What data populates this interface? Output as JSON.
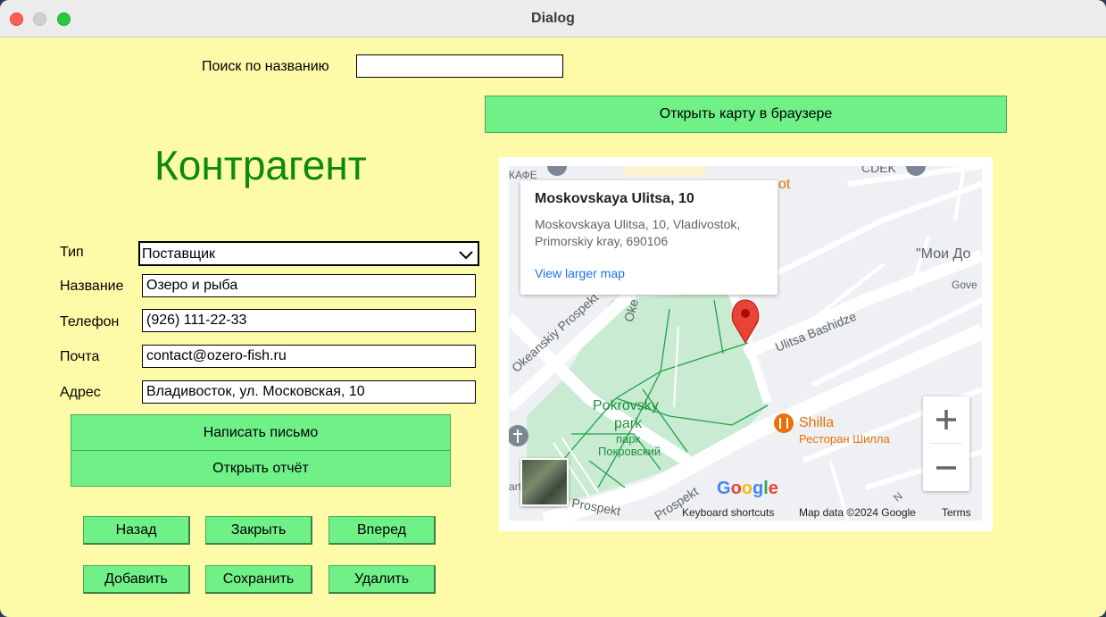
{
  "window": {
    "title": "Dialog"
  },
  "search": {
    "label": "Поиск по названию",
    "value": ""
  },
  "open_map_button": "Открыть карту в браузере",
  "heading": "Контрагент",
  "form": {
    "type_label": "Тип",
    "type_value": "Поставщик",
    "name_label": "Название",
    "name_value": "Озеро и рыба",
    "phone_label": "Телефон",
    "phone_value": "(926) 111-22-33",
    "email_label": "Почта",
    "email_value": "contact@ozero-fish.ru",
    "address_label": "Адрес",
    "address_value": "Владивосток, ул. Московская, 10"
  },
  "actions": {
    "write_letter": "Написать письмо",
    "open_report": "Открыть отчёт"
  },
  "nav": {
    "back": "Назад",
    "close": "Закрыть",
    "forward": "Вперед",
    "add": "Добавить",
    "save": "Сохранить",
    "delete": "Удалить"
  },
  "map": {
    "info_title": "Moskovskaya Ulitsa, 10",
    "info_address": "Moskovskaya Ulitsa, 10, Vladivostok, Primorskiy kray, 690106",
    "view_larger": "View larger map",
    "labels": {
      "okeanskiy": "Okeanskiy Prospekt",
      "prospekt": "Prospekt",
      "ulitsa_bashidze": "Ulitsa Bashidze",
      "park_en_1": "Pokrovsky",
      "park_en_2": "park",
      "park_ru_1": "парк",
      "park_ru_2": "Покровский",
      "shilla": "Shilla",
      "shilla_ru": "Ресторан Шилла",
      "moi_do": "\"Мои До",
      "gove": "Gove",
      "kafe": "КАФЕ",
      "ot": "ot",
      "cdek": "CDEK",
      "oke": "Oke",
      "prospekt_lower": "Prospekt",
      "art": "art",
      "n": "N"
    },
    "google": "Google",
    "footer_shortcuts": "Keyboard shortcuts",
    "footer_data": "Map data ©2024 Google",
    "footer_terms": "Terms"
  },
  "colors": {
    "window_bg": "#fefba8",
    "button_green": "#6ff187",
    "heading_green": "#0c8a0c",
    "park": "#c8ebd1",
    "marker_red": "#ea4335",
    "restaurant_orange": "#e8710a",
    "link_blue": "#1a73e8"
  }
}
